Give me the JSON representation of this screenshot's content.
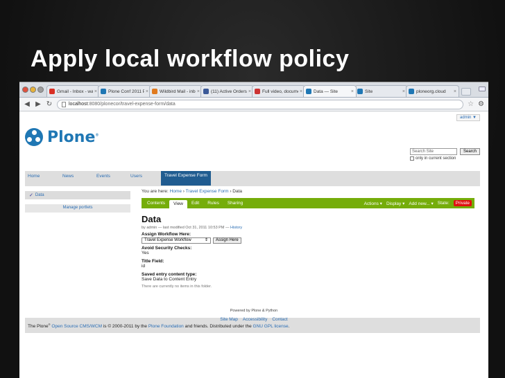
{
  "slide": {
    "title": "Apply local workflow policy"
  },
  "browser": {
    "tabs": [
      {
        "label": "Gmail - Inbox - wal",
        "color": "#d93025"
      },
      {
        "label": "Plone Conf 2011 Pr",
        "color": "#1f77b4"
      },
      {
        "label": "Wildbird Mail - inbo",
        "color": "#e07a1f"
      },
      {
        "label": "(11) Active Orders",
        "color": "#3b5998"
      },
      {
        "label": "Full video, documen",
        "color": "#cc3333"
      },
      {
        "label": "Data — Site",
        "color": "#1f77b4"
      },
      {
        "label": "Site",
        "color": "#1f77b4"
      },
      {
        "label": "ploneorg.cloud",
        "color": "#1f77b4"
      }
    ],
    "address": {
      "host": "localhost",
      "rest": ":8080/plonecor/travel-expense-form/data"
    }
  },
  "site": {
    "user_menu": "admin ▼",
    "logo_text": "Plone",
    "search": {
      "placeholder": "Search Site",
      "button": "Search",
      "option": "only in current section"
    },
    "global_nav": [
      {
        "label": "Home"
      },
      {
        "label": "News"
      },
      {
        "label": "Events"
      },
      {
        "label": "Users"
      },
      {
        "label": "Travel Expense Form",
        "selected": true
      }
    ],
    "portlets": {
      "nav_item": "Data",
      "manage": "Manage portlets"
    },
    "breadcrumbs": {
      "prefix": "You are here:",
      "home": "Home",
      "sep1": " › ",
      "section": "Travel Expense Form",
      "sep2": " › ",
      "current": "Data"
    },
    "content_views": [
      {
        "label": "Contents"
      },
      {
        "label": "View",
        "selected": true
      },
      {
        "label": "Edit"
      },
      {
        "label": "Rules"
      },
      {
        "label": "Sharing"
      }
    ],
    "content_actions": {
      "actions": "Actions ▾",
      "display": "Display ▾",
      "add_new": "Add new... ▾",
      "state_label": "State:",
      "state_value": "Private"
    },
    "document": {
      "title": "Data",
      "byline": "by admin — last modified Oct 31, 2011 10:53 PM —",
      "history": "History",
      "assign_label": "Assign Workflow Here:",
      "assign_select": "Travel Expense Workflow",
      "assign_button": "Assign Here",
      "fields": [
        {
          "label": "Avoid Security Checks:",
          "value": "Yes"
        },
        {
          "label": "Title Field:",
          "value": "id"
        },
        {
          "label": "Saved entry content type:",
          "value": "Save Data to Content Entry"
        }
      ],
      "note": "There are currently no items in this folder."
    },
    "footer": {
      "p1": "The Plone",
      "tm": "®",
      "link1": "Open Source CMS/WCM",
      "p2": " is © 2000-2011 by the ",
      "link2": "Plone Foundation",
      "p3": " and friends. Distributed under the ",
      "link3": "GNU GPL license",
      "p4": "."
    },
    "colophon": {
      "powered": "Powered by Plone & Python",
      "links": [
        "Site Map",
        "Accessibility",
        "Contact"
      ]
    }
  }
}
